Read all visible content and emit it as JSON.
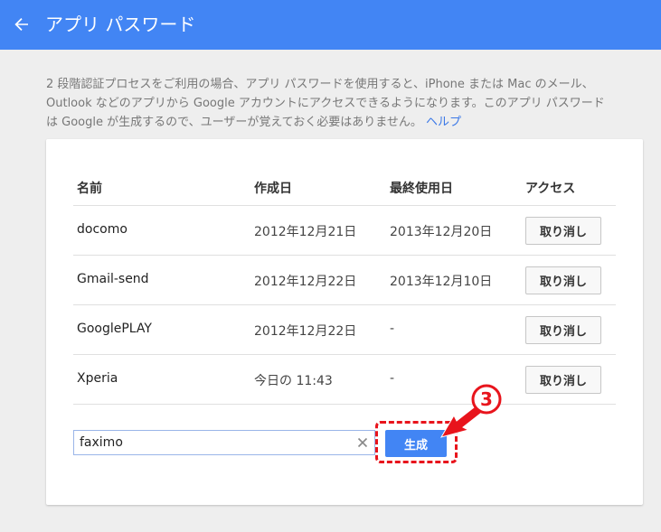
{
  "header": {
    "title": "アプリ パスワード",
    "bg_color": "#4285f4"
  },
  "description": {
    "line1": "2 段階認証プロセスをご利用の場合、アプリ パスワードを使用すると、iPhone または Mac のメール、",
    "line2": "Outlook などのアプリから Google アカウントにアクセスできるようになります。このアプリ パスワード",
    "line3": "は Google が生成するので、ユーザーが覚えておく必要はありません。",
    "help_link": "ヘルプ"
  },
  "table": {
    "columns": [
      "名前",
      "作成日",
      "最終使用日",
      "アクセス"
    ],
    "rows": [
      {
        "name": "docomo",
        "created": "2012年12月21日",
        "last_used": "2013年12月20日",
        "action": "取り消し"
      },
      {
        "name": "Gmail-send",
        "created": "2012年12月22日",
        "last_used": "2013年12月10日",
        "action": "取り消し"
      },
      {
        "name": "GooglePLAY",
        "created": "2012年12月22日",
        "last_used": "-",
        "action": "取り消し"
      },
      {
        "name": "Xperia",
        "created": "今日の 11:43",
        "last_used": "-",
        "action": "取り消し"
      }
    ]
  },
  "new_app": {
    "input_value": "faximo",
    "generate_label": "生成"
  },
  "annotation": {
    "step_number": "3",
    "color": "#e8141c"
  }
}
